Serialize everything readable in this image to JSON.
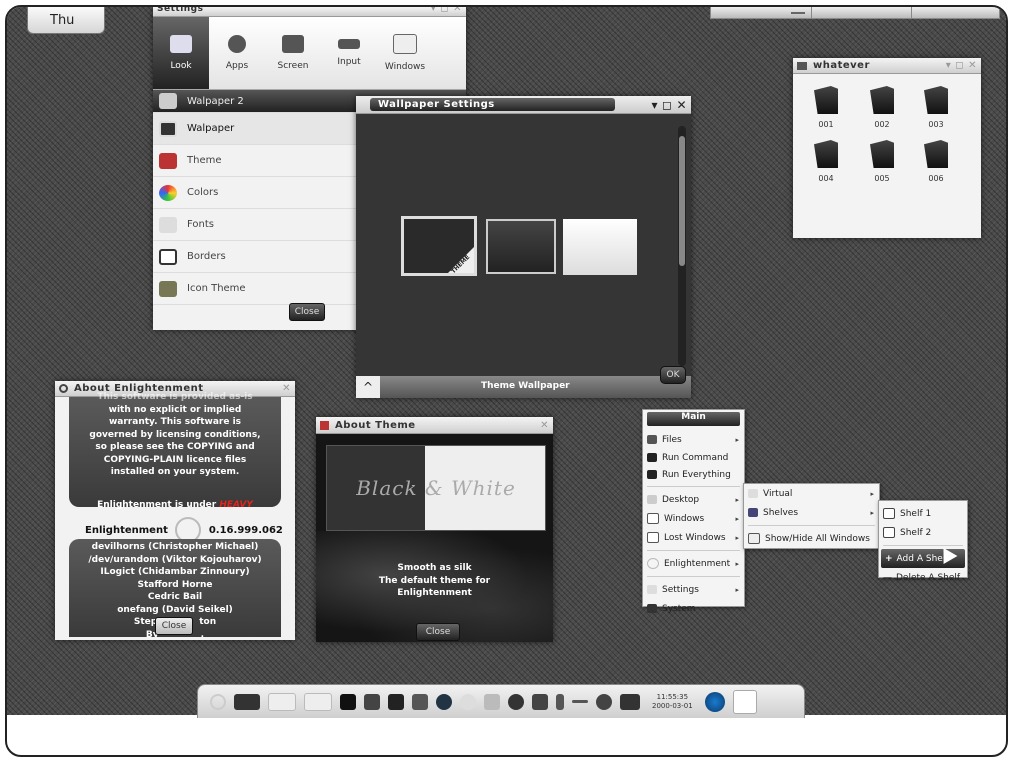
{
  "desktop": {
    "day_button": "Thu"
  },
  "settings": {
    "title": "Settings",
    "toolbar": [
      {
        "label": "Look"
      },
      {
        "label": "Apps"
      },
      {
        "label": "Screen"
      },
      {
        "label": "Input"
      },
      {
        "label": "Windows"
      }
    ],
    "header": "Walpaper 2",
    "items": [
      {
        "label": "Walpaper"
      },
      {
        "label": "Theme"
      },
      {
        "label": "Colors"
      },
      {
        "label": "Fonts"
      },
      {
        "label": "Borders"
      },
      {
        "label": "Icon Theme"
      }
    ],
    "close_label": "Close"
  },
  "wallpaper": {
    "title": "Wallpaper Settings",
    "thumb_label": "THEME",
    "footer": "Theme Wallpaper",
    "ok_label": "OK"
  },
  "whatever": {
    "title": "whatever",
    "folders": [
      "001",
      "002",
      "003",
      "004",
      "005",
      "006"
    ]
  },
  "about_e": {
    "title": "About Enlightenment",
    "lines": [
      "This software is provided as-is",
      "with no explicit or implied",
      "warranty. This software is",
      "governed by licensing conditions,",
      "so please see the COPYING and",
      "COPYING-PLAIN licence files",
      "installed on your system."
    ],
    "released": "Enlightenment is under",
    "released_tag": "HEAVY",
    "version_name": "Enlightenment",
    "version": "0.16.999.062",
    "authors": [
      "devilhorns (Christopher Michael)",
      "/dev/urandom (Viktor Kojouharov)",
      "ILogict (Chidambar Zinnoury)",
      "Stafford Horne",
      "Cedric Bail",
      "onefang (David Seikel)",
      "Step",
      "ton",
      "By",
      "."
    ],
    "close_label": "Close"
  },
  "about_theme": {
    "title": "About Theme",
    "banner": "Black & White",
    "lines": [
      "Smooth as silk",
      "The default theme for",
      "Enlightenment"
    ],
    "close_label": "Close"
  },
  "main_menu": {
    "title": "Main",
    "items": [
      "Files",
      "Run Command",
      "Run Everything",
      "Desktop",
      "Windows",
      "Lost Windows",
      "Enlightenment",
      "Settings",
      "System"
    ]
  },
  "sub_menu": {
    "items": [
      "Virtual",
      "Shelves",
      "Show/Hide All Windows"
    ]
  },
  "shelf_menu": {
    "items": [
      "Shelf 1",
      "Shelf 2",
      "Add A Shelf",
      "Delete A Shelf"
    ]
  },
  "taskbar": {
    "clock_time": "11:55:35",
    "clock_date": "2000-03-01"
  },
  "colors": {
    "desktop_bg": "#4a4a4a",
    "window_bg": "#f2f2f2",
    "accent_dark": "#222222",
    "highlight": "#e8231a"
  }
}
